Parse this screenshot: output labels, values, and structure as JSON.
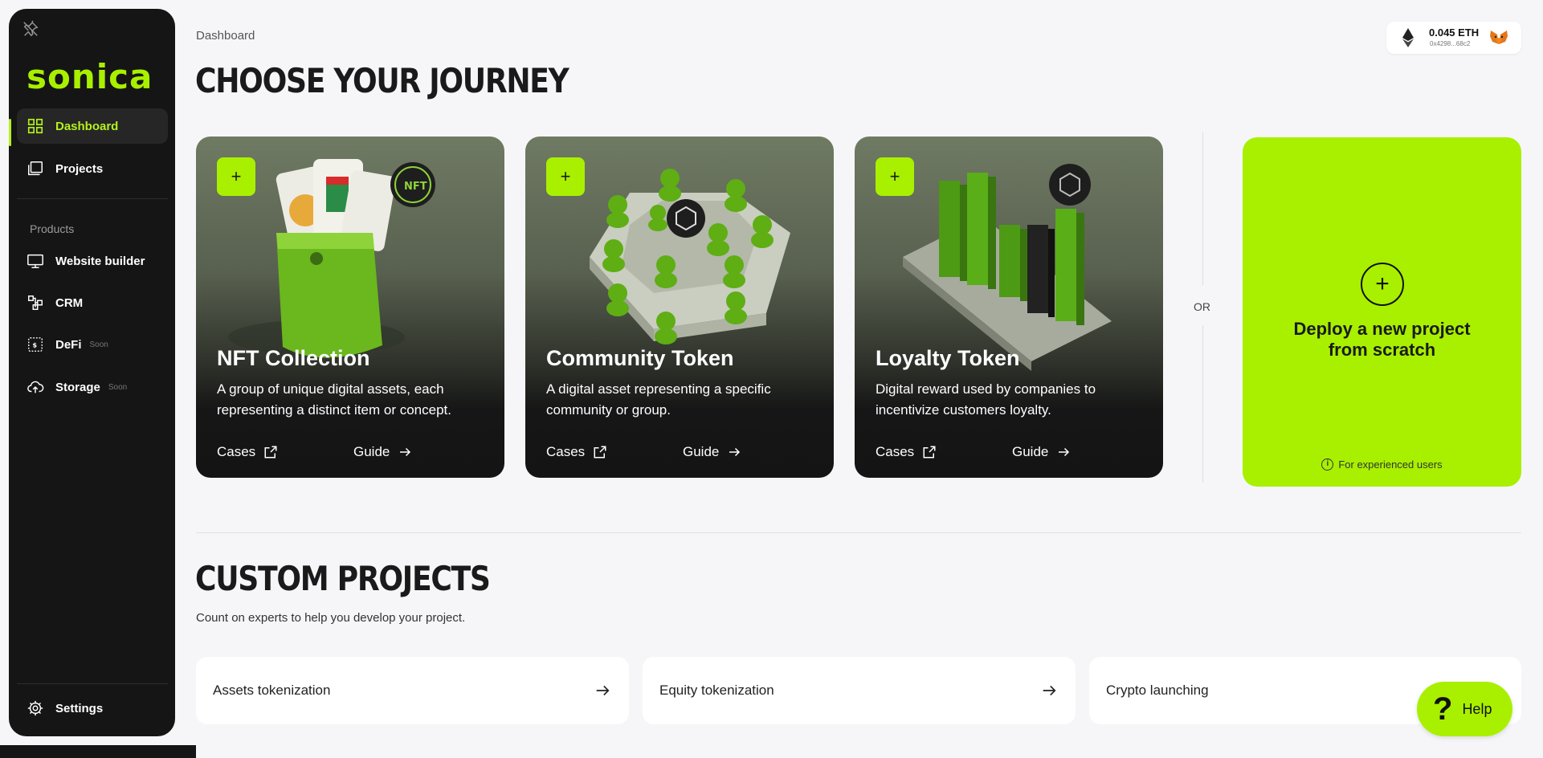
{
  "sidebar": {
    "logo": "sonica",
    "nav": [
      {
        "label": "Dashboard",
        "icon": "grid-icon",
        "active": true
      },
      {
        "label": "Projects",
        "icon": "folders-icon"
      }
    ],
    "products_label": "Products",
    "products": [
      {
        "label": "Website builder",
        "icon": "monitor-icon",
        "badge": ""
      },
      {
        "label": "CRM",
        "icon": "crm-icon",
        "badge": ""
      },
      {
        "label": "DeFi",
        "icon": "defi-icon",
        "badge": "Soon"
      },
      {
        "label": "Storage",
        "icon": "cloud-upload-icon",
        "badge": "Soon"
      }
    ],
    "settings_label": "Settings"
  },
  "header": {
    "breadcrumb": "Dashboard",
    "title": "CHOOSE YOUR JOURNEY"
  },
  "wallet": {
    "amount": "0.045 ETH",
    "address": "0x4298...68c2"
  },
  "journeys": [
    {
      "title": "NFT Collection",
      "description": "A group of unique digital assets, each representing a distinct item or concept.",
      "cases_label": "Cases",
      "guide_label": "Guide"
    },
    {
      "title": "Community Token",
      "description": "A digital asset representing a specific community or group.",
      "cases_label": "Cases",
      "guide_label": "Guide"
    },
    {
      "title": "Loyalty Token",
      "description": "Digital reward used by companies to incentivize customers loyalty.",
      "cases_label": "Cases",
      "guide_label": "Guide"
    }
  ],
  "or_label": "OR",
  "deploy": {
    "title_line1": "Deploy a new project",
    "title_line2": "from scratch",
    "note": "For experienced users"
  },
  "custom": {
    "title": "CUSTOM PROJECTS",
    "subtitle": "Count on experts to help you develop your project.",
    "items": [
      {
        "label": "Assets tokenization"
      },
      {
        "label": "Equity tokenization"
      },
      {
        "label": "Crypto launching"
      }
    ]
  },
  "help": {
    "label": "Help"
  },
  "colors": {
    "accent": "#a8f000",
    "sidebar": "#151515",
    "background": "#f6f6f8"
  }
}
